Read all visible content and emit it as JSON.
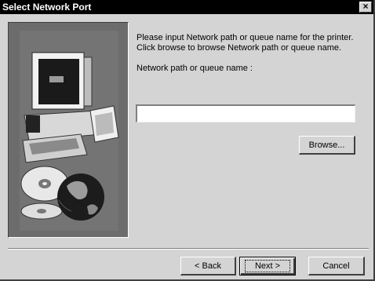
{
  "window": {
    "title": "Select Network Port",
    "close_glyph": "×"
  },
  "content": {
    "prompt_line1": "Please input Network path or queue name for the printer.",
    "prompt_line2": "Click browse to browse Network path or queue name.",
    "field_label": "Network path or queue name :",
    "path_value": ""
  },
  "buttons": {
    "browse": "Browse...",
    "back": "< Back",
    "next": "Next >",
    "cancel": "Cancel"
  },
  "illustration": {
    "description_icons": [
      "computer-icon",
      "cd-disc-icon",
      "globe-icon"
    ]
  }
}
